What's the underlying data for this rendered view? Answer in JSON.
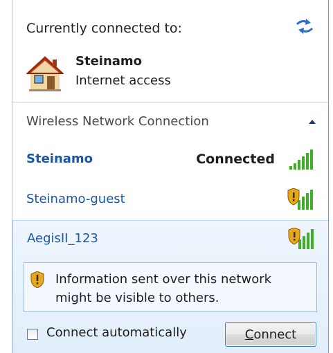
{
  "header": {
    "title": "Currently connected to:",
    "refresh_icon": "refresh-arrows-icon"
  },
  "current_connection": {
    "name": "Steinamo",
    "status": "Internet access",
    "icon": "house-icon"
  },
  "section": {
    "title": "Wireless Network Connection",
    "collapse_icon": "chevron-up-icon"
  },
  "networks": [
    {
      "name": "Steinamo",
      "state": "Connected",
      "secured": true,
      "shield": false
    },
    {
      "name": "Steinamo-guest",
      "state": "",
      "secured": false,
      "shield": true
    },
    {
      "name": "AegisII_123",
      "state": "",
      "secured": false,
      "shield": true
    }
  ],
  "selected": {
    "warning": "Information sent over this network might be visible to others.",
    "auto_connect_label": "Connect automatically",
    "auto_connect_checked": false,
    "connect_label_first": "C",
    "connect_label_rest": "onnect"
  },
  "colors": {
    "link": "#1a57a8",
    "signal_green": "#3fae2a",
    "shield_gold": "#e8a81c"
  }
}
